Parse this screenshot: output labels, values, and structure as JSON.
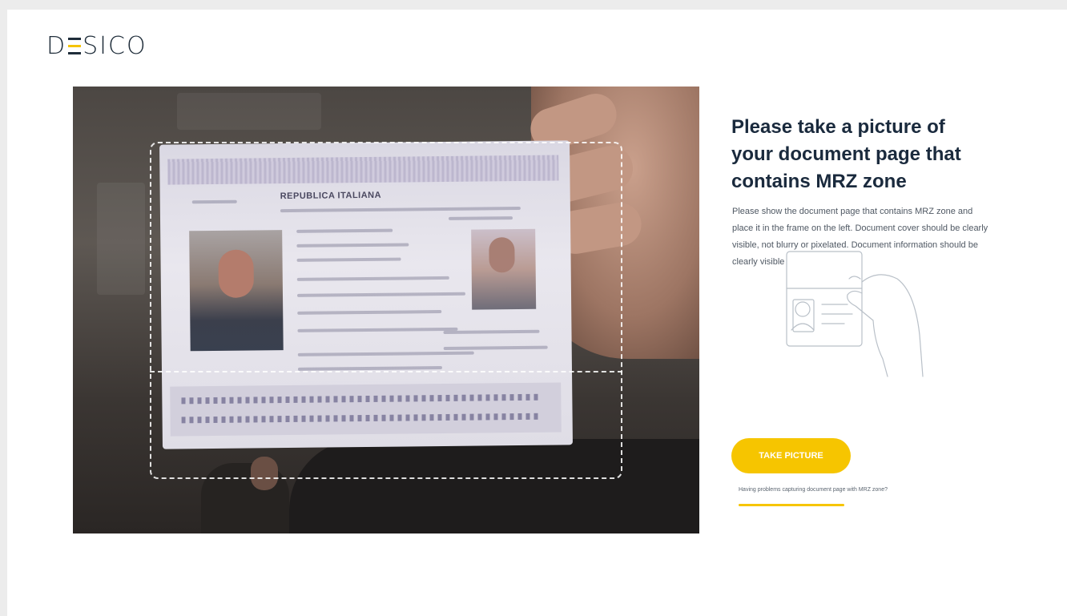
{
  "brand": {
    "logo_left": "D",
    "logo_right": "SICO",
    "accent": "#f6c500",
    "text_color": "#1f2d3a"
  },
  "camera": {
    "description_icon": "camera-feed"
  },
  "passport": {
    "header": "REPUBLICA ITALIANA"
  },
  "instructions": {
    "title": "Please take a picture of your document page that contains MRZ zone",
    "body": "Please show the document page that contains MRZ zone and place it in the frame on the left. Document cover should be clearly visible, not blurry or pixelated. Document information should be clearly visible"
  },
  "actions": {
    "take_picture": "TAKE PICTURE",
    "help_link": "Having problems capturing document page with MRZ zone?"
  }
}
